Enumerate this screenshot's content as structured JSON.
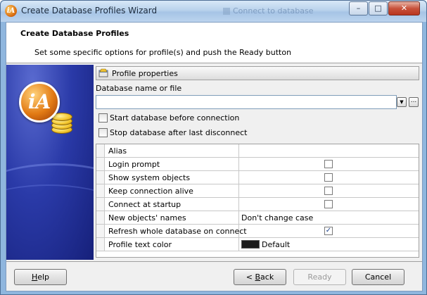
{
  "window": {
    "title": "Create Database Profiles Wizard",
    "background_ghost_text": "Connect to database",
    "buttons": {
      "minimize": "–",
      "maximize": "□",
      "close": "✕"
    }
  },
  "header": {
    "title": "Create Database Profiles",
    "subtitle": "Set some specific options for profile(s) and push the Ready button"
  },
  "banner": {
    "logo_text": "iA"
  },
  "profile_properties": {
    "section_label": "Profile properties",
    "db_name_label": "Database name or file",
    "db_name_value": "",
    "dropdown_glyph": "▼",
    "browse_glyph": "...",
    "start_db_label": "Start database before connection",
    "start_db_checked": false,
    "stop_db_label": "Stop database after last disconnect",
    "stop_db_checked": false
  },
  "grid": {
    "rows": [
      {
        "name": "Alias",
        "type": "text",
        "value": ""
      },
      {
        "name": "Login prompt",
        "type": "checkbox",
        "checked": false
      },
      {
        "name": "Show system objects",
        "type": "checkbox",
        "checked": false
      },
      {
        "name": "Keep connection alive",
        "type": "checkbox",
        "checked": false
      },
      {
        "name": "Connect at startup",
        "type": "checkbox",
        "checked": false
      },
      {
        "name": "New objects' names",
        "type": "text",
        "value": "Don't change case"
      },
      {
        "name": "Refresh whole database on connect",
        "type": "checkbox",
        "checked": true,
        "mark": "✓"
      },
      {
        "name": "Profile text color",
        "type": "color",
        "value": "Default",
        "color": "#1a1a1a"
      }
    ]
  },
  "footer": {
    "help_hotkey": "H",
    "help_rest": "elp",
    "back_prefix": "< ",
    "back_hotkey": "B",
    "back_rest": "ack",
    "ready_label": "Ready",
    "cancel_label": "Cancel"
  }
}
